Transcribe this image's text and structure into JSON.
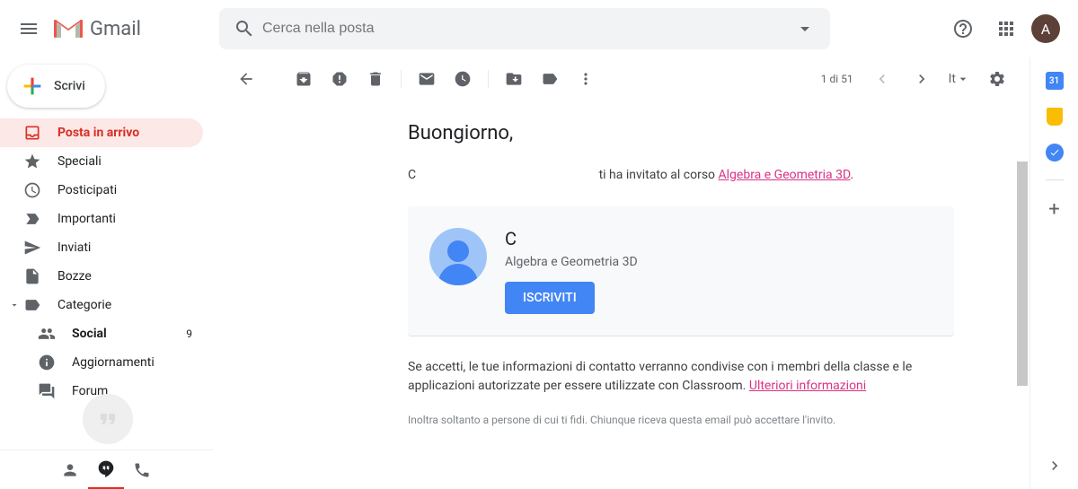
{
  "header": {
    "app_name": "Gmail",
    "search_placeholder": "Cerca nella posta",
    "account_initial": "A"
  },
  "compose": {
    "label": "Scrivi"
  },
  "sidebar": {
    "items": [
      {
        "label": "Posta in arrivo",
        "count": ""
      },
      {
        "label": "Speciali"
      },
      {
        "label": "Posticipati"
      },
      {
        "label": "Importanti"
      },
      {
        "label": "Inviati"
      },
      {
        "label": "Bozze"
      },
      {
        "label": "Categorie"
      }
    ],
    "categories": [
      {
        "label": "Social",
        "count": "9"
      },
      {
        "label": "Aggiornamenti"
      },
      {
        "label": "Forum"
      }
    ]
  },
  "toolbar": {
    "pagination": "1 di 51",
    "input_tool": "It"
  },
  "email": {
    "subject": "Buongiorno,",
    "sender_initial": "C",
    "invite_text_mid": " ti ha invitato al corso ",
    "course_link": "Algebra e Geometria 3D",
    "period": ".",
    "card_name": "C",
    "card_course": "Algebra e Geometria 3D",
    "enroll_button": "ISCRIVITI",
    "disclaimer_text": "Se accetti, le tue informazioni di contatto verranno condivise con i membri della classe e le applicazioni autorizzate per essere utilizzate con Classroom. ",
    "disclaimer_link": "Ulteriori informazioni",
    "footnote": "Inoltra soltanto a persone di cui ti fidi. Chiunque riceva questa email può accettare l'invito."
  },
  "side_panel": {
    "calendar_badge": "31"
  }
}
